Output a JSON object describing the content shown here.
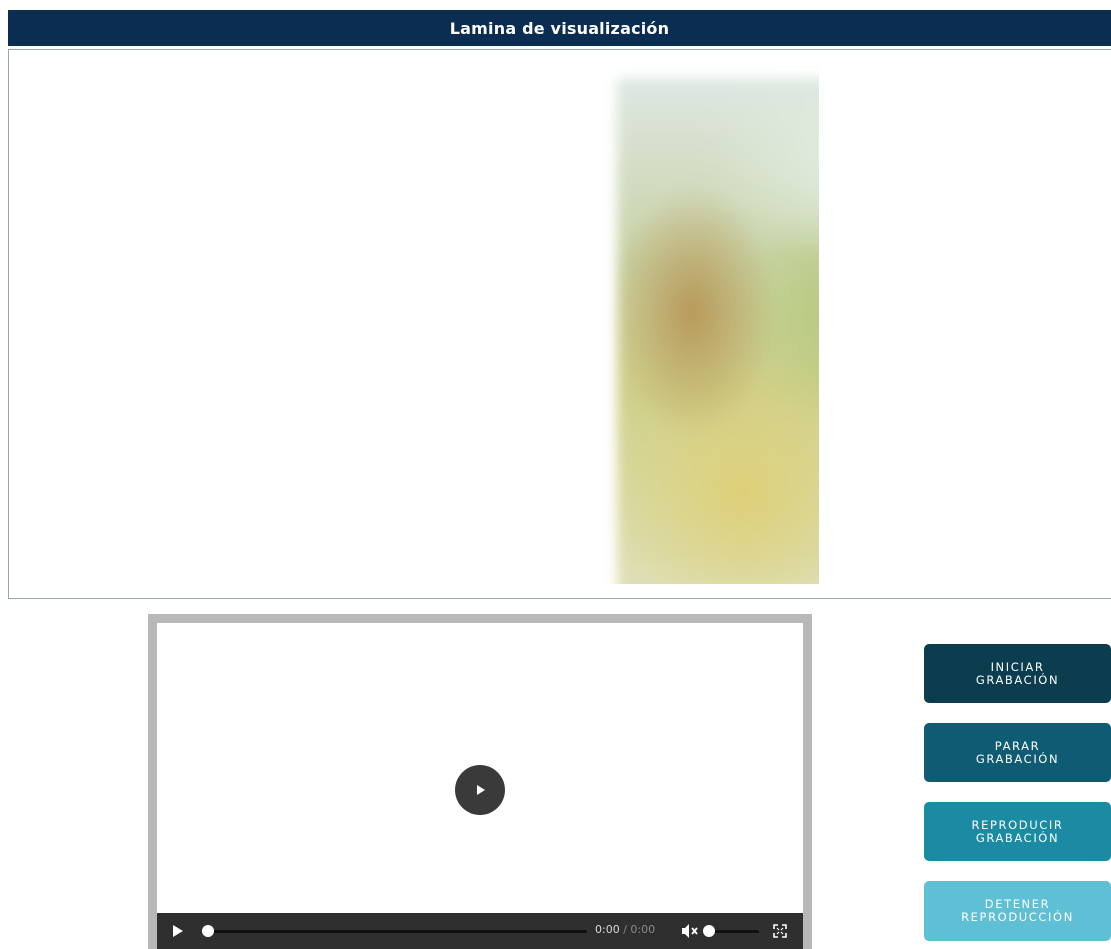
{
  "header": {
    "title": "Lamina de visualización"
  },
  "viewer": {
    "image_icon": "blurred-image"
  },
  "player": {
    "current_time": "0:00",
    "separator": " / ",
    "duration": "0:00",
    "progress": 0,
    "volume": 0,
    "icons": {
      "big_play": "play-circle-icon",
      "play": "play-icon",
      "mute": "volume-mute-icon",
      "fullscreen": "fullscreen-icon"
    }
  },
  "buttons": [
    {
      "line1": "INICIAR",
      "line2": "GRABACIÓN",
      "color": "#0b3d4f"
    },
    {
      "line1": "PARAR",
      "line2": "GRABACIÓN",
      "color": "#0f5b74"
    },
    {
      "line1": "REPRODUCIR",
      "line2": "GRABACIÓN",
      "color": "#1a8ba3"
    },
    {
      "line1": "DETENER",
      "line2": "REPRODUCCIÓN",
      "color": "#5fbfd4"
    }
  ],
  "colors": {
    "title_bar": "#0c2d52",
    "player_frame": "#b8b8b8",
    "controls_bg": "#2f2f2f"
  }
}
